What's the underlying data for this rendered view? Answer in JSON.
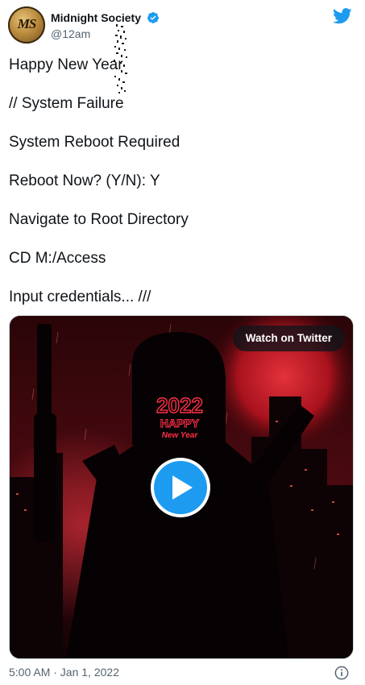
{
  "tweet": {
    "author": {
      "display_name": "Midnight Society",
      "handle": "@12am",
      "avatar_monogram": "MS",
      "verified": true
    },
    "lines": [
      "Happy New Year",
      "// System Failure",
      "System Reboot Required",
      "Reboot Now? (Y/N): Y",
      "Navigate to Root Directory",
      "CD M:/Access",
      "Input credentials... ///"
    ],
    "media": {
      "watch_label": "Watch on Twitter",
      "mask_text_year": "2022",
      "mask_text_happy": "HAPPY",
      "mask_text_newyear": "New Year"
    },
    "timestamp": "5:00 AM · Jan 1, 2022"
  },
  "icons": {
    "brand": "twitter-bird-icon",
    "verified": "verified-badge-icon",
    "play": "play-icon",
    "info": "info-icon"
  },
  "colors": {
    "twitter_blue": "#1d9bf0",
    "text_primary": "#0f1419",
    "text_secondary": "#536471",
    "scene_red": "#c81c28"
  }
}
